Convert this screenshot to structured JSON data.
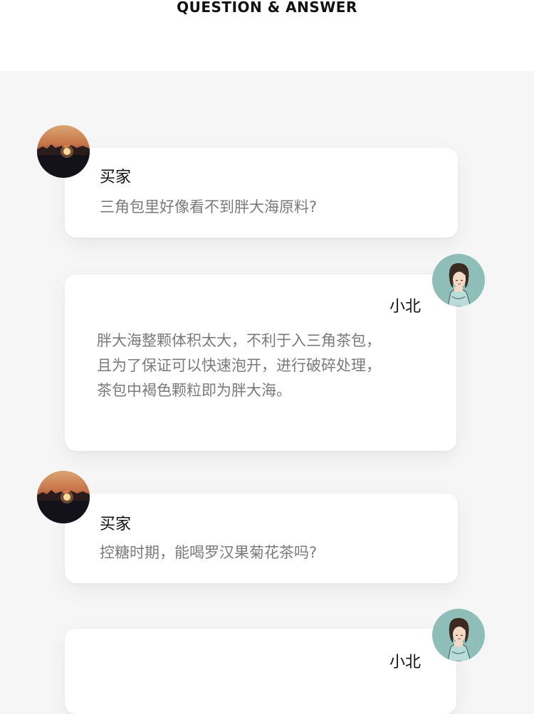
{
  "header": {
    "title": "QUESTION & ANSWER"
  },
  "conversation": [
    {
      "role": "buyer",
      "speaker": "买家",
      "text": "三角包里好像看不到胖大海原料?"
    },
    {
      "role": "seller",
      "speaker": "小北",
      "text": "胖大海整颗体积太大，不利于入三角茶包，\n且为了保证可以快速泡开，进行破碎处理，\n茶包中褐色颗粒即为胖大海。"
    },
    {
      "role": "buyer",
      "speaker": "买家",
      "text": "控糖时期，能喝罗汉果菊花茶吗?"
    },
    {
      "role": "seller",
      "speaker": "小北",
      "text": ""
    }
  ],
  "avatars": {
    "buyer": {
      "icon": "sunset-avatar-icon"
    },
    "seller": {
      "icon": "woman-illustration-avatar-icon",
      "background": "#8fbdb8"
    }
  },
  "colors": {
    "page_background": "#f6f6f6",
    "card_background": "#ffffff",
    "speaker_text": "#111111",
    "message_text": "#7a7a7a"
  }
}
